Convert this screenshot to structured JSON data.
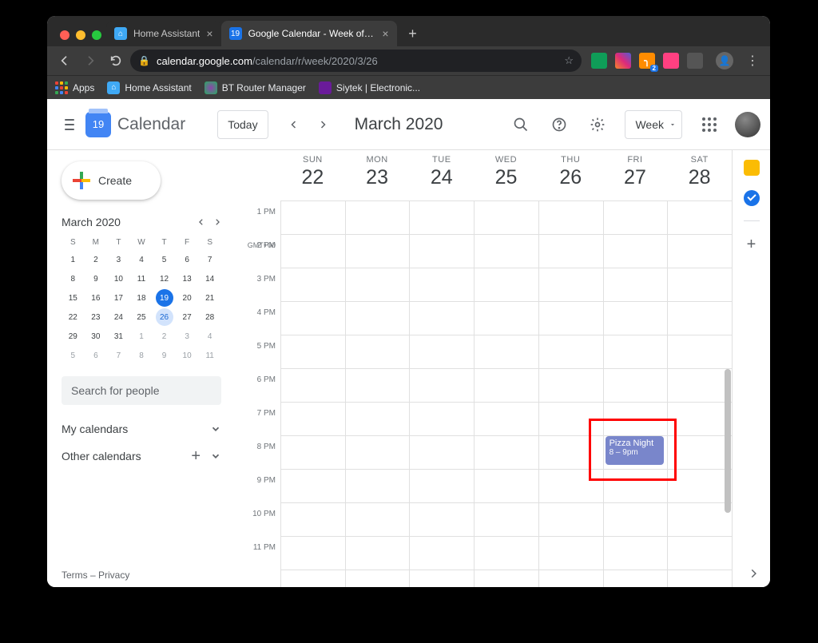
{
  "browser": {
    "tabs": [
      {
        "title": "Home Assistant",
        "active": false
      },
      {
        "title": "Google Calendar - Week of Ma",
        "active": true
      }
    ],
    "url_host": "calendar.google.com",
    "url_path": "/calendar/r/week/2020/3/26",
    "rss_badge": "2",
    "bookmarks": {
      "apps": "Apps",
      "home_assistant": "Home Assistant",
      "bt_router": "BT Router Manager",
      "siytek": "Siytek | Electronic..."
    }
  },
  "header": {
    "logo_day": "19",
    "logo_text": "Calendar",
    "today": "Today",
    "range": "March 2020",
    "view": "Week"
  },
  "sidebar": {
    "create": "Create",
    "minical_title": "March 2020",
    "dow": [
      "S",
      "M",
      "T",
      "W",
      "T",
      "F",
      "S"
    ],
    "weeks": [
      [
        {
          "d": "1"
        },
        {
          "d": "2"
        },
        {
          "d": "3"
        },
        {
          "d": "4"
        },
        {
          "d": "5"
        },
        {
          "d": "6"
        },
        {
          "d": "7"
        }
      ],
      [
        {
          "d": "8"
        },
        {
          "d": "9"
        },
        {
          "d": "10"
        },
        {
          "d": "11"
        },
        {
          "d": "12"
        },
        {
          "d": "13"
        },
        {
          "d": "14"
        }
      ],
      [
        {
          "d": "15"
        },
        {
          "d": "16"
        },
        {
          "d": "17"
        },
        {
          "d": "18"
        },
        {
          "d": "19",
          "today": true
        },
        {
          "d": "20"
        },
        {
          "d": "21"
        }
      ],
      [
        {
          "d": "22"
        },
        {
          "d": "23"
        },
        {
          "d": "24"
        },
        {
          "d": "25"
        },
        {
          "d": "26",
          "selected": true
        },
        {
          "d": "27"
        },
        {
          "d": "28"
        }
      ],
      [
        {
          "d": "29"
        },
        {
          "d": "30"
        },
        {
          "d": "31"
        },
        {
          "d": "1",
          "other": true
        },
        {
          "d": "2",
          "other": true
        },
        {
          "d": "3",
          "other": true
        },
        {
          "d": "4",
          "other": true
        }
      ],
      [
        {
          "d": "5",
          "other": true
        },
        {
          "d": "6",
          "other": true
        },
        {
          "d": "7",
          "other": true
        },
        {
          "d": "8",
          "other": true
        },
        {
          "d": "9",
          "other": true
        },
        {
          "d": "10",
          "other": true
        },
        {
          "d": "11",
          "other": true
        }
      ]
    ],
    "search_placeholder": "Search for people",
    "my_calendars": "My calendars",
    "other_calendars": "Other calendars",
    "terms": "Terms",
    "dash": " – ",
    "privacy": "Privacy"
  },
  "week": {
    "tz": "GMT+00",
    "days": [
      {
        "dow": "SUN",
        "dom": "22"
      },
      {
        "dow": "MON",
        "dom": "23"
      },
      {
        "dow": "TUE",
        "dom": "24"
      },
      {
        "dow": "WED",
        "dom": "25"
      },
      {
        "dow": "THU",
        "dom": "26"
      },
      {
        "dow": "FRI",
        "dom": "27"
      },
      {
        "dow": "SAT",
        "dom": "28"
      }
    ],
    "hours": [
      "1 PM",
      "2 PM",
      "3 PM",
      "4 PM",
      "5 PM",
      "6 PM",
      "7 PM",
      "8 PM",
      "9 PM",
      "10 PM",
      "11 PM"
    ],
    "event": {
      "title": "Pizza Night",
      "time": "8 – 9pm",
      "day_index": 5,
      "start_hour_index": 7,
      "duration_hours": 1
    }
  }
}
